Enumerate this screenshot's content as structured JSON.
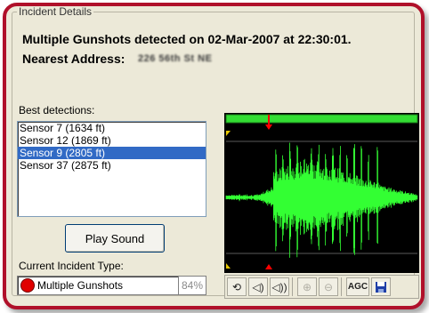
{
  "group_title": "Incident Details",
  "headline": "Multiple Gunshots detected on 02-Mar-2007 at 22:30:01.",
  "address": {
    "label": "Nearest Address:",
    "value": "226 56th St NE"
  },
  "detections": {
    "label": "Best detections:",
    "items": [
      {
        "text": "Sensor 7   (1634 ft)",
        "selected": false
      },
      {
        "text": "Sensor 12   (1869 ft)",
        "selected": false
      },
      {
        "text": "Sensor 9   (2805 ft)",
        "selected": true
      },
      {
        "text": "Sensor 37   (2875 ft)",
        "selected": false
      }
    ]
  },
  "play_button": "Play Sound",
  "incident_type": {
    "label": "Current Incident Type:",
    "value": "Multiple Gunshots",
    "confidence": "84%",
    "indicator_color": "#e00000"
  },
  "waveform": {
    "background": "#000000",
    "wave_color": "#33ff33",
    "scrubber_color": "#33dd33",
    "playhead_color": "#ff0000"
  },
  "toolbar": {
    "loop_icon": "loop-icon",
    "volume_down_icon": "volume-down-icon",
    "volume_up_icon": "volume-up-icon",
    "zoom_in_icon": "zoom-in-icon",
    "zoom_out_icon": "zoom-out-icon",
    "agc_label": "AGC",
    "save_icon": "save-icon"
  }
}
